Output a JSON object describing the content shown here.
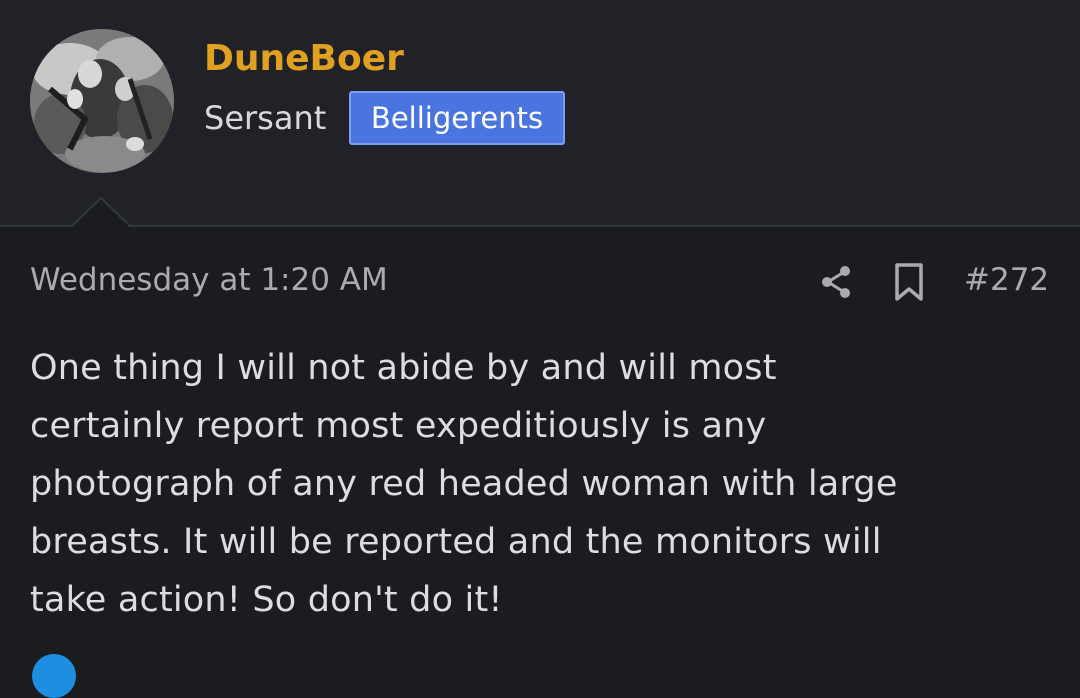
{
  "user": {
    "name": "DuneBoer",
    "rank": "Sersant",
    "badge": "Belligerents"
  },
  "post": {
    "timestamp": "Wednesday at 1:20 AM",
    "number": "#272",
    "lines": [
      "One thing I will not abide by and will most",
      "certainly report most expeditiously is any",
      "photograph of any red headed woman with large",
      "breasts. It will be reported and the monitors will",
      "take action! So don't do it!"
    ]
  },
  "icons": {
    "share": "share-icon",
    "bookmark": "bookmark-icon",
    "reaction": "like-reaction-icon"
  },
  "colors": {
    "username": "#e0a020",
    "badge": "#4a74e0",
    "background": "#1b1c1f",
    "header": "#202228"
  }
}
